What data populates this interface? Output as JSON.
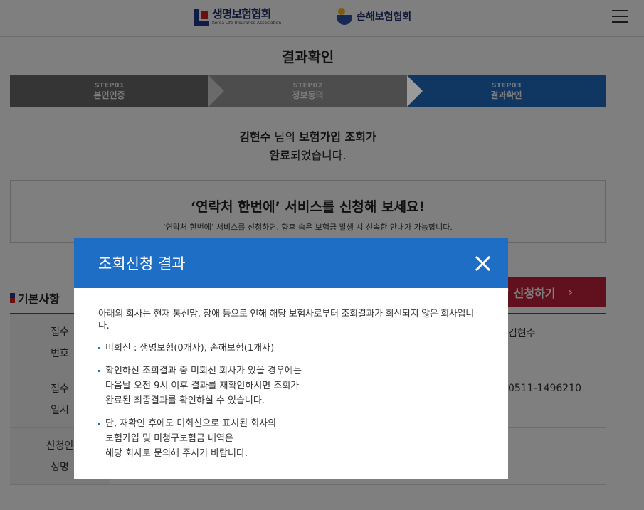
{
  "header": {
    "logo1_ko": "생명보험협회",
    "logo1_en": "Korea Life Insurance Association",
    "logo2": "손해보험협회"
  },
  "page_title": "결과확인",
  "steps": [
    {
      "num": "STEP01",
      "label": "본인인증"
    },
    {
      "num": "STEP02",
      "label": "정보동의"
    },
    {
      "num": "STEP03",
      "label": "결과확인"
    }
  ],
  "result": {
    "name": "김현수",
    "suffix1": " 님의 ",
    "bold1": "보험가입 조회가",
    "bold2": "완료",
    "suffix2": "되었습니다."
  },
  "service": {
    "title": "‘연락처 한번에’ 서비스를 신청해 보세요!",
    "desc": "‘연락처 한번에’ 서비스를 신청하면, 향후 숨은 보험금 발생 시 신속한 안내가 가능합니다."
  },
  "basic": {
    "title": "기본사항",
    "apply_label": "’ 신청하기"
  },
  "table": [
    {
      "header1": "접수",
      "header2": "번호",
      "value": "김현수"
    },
    {
      "header1": "접수",
      "header2": "일시",
      "value": "0511-1496210"
    },
    {
      "header1": "신청인",
      "header2": "성명",
      "value": ""
    }
  ],
  "modal": {
    "title": "조회신청 결과",
    "intro": "아래의 회사는 현재 통신망, 장애 등으로 인해 해당 보험사로부터 조회결과가 회신되지 않은 회사입니다.",
    "bullet1": "미회신 : 생명보험(0개사), 손해보험(1개사)",
    "bullet2_l1": "확인하신 조회결과 중 미회신 회사가 있을 경우에는",
    "bullet2_l2": "다음날 오전 9시 이후 결과를 재확인하시면 조회가",
    "bullet2_l3": "완료된 최종결과를 확인하실 수 있습니다.",
    "bullet3_l1": "단, 재확인 후에도 미회신으로 표시된 회사의",
    "bullet3_l2": "보험가입 및 미청구보험금 내역은",
    "bullet3_l3": "해당 회사로 문의해 주시기 바랍니다."
  }
}
